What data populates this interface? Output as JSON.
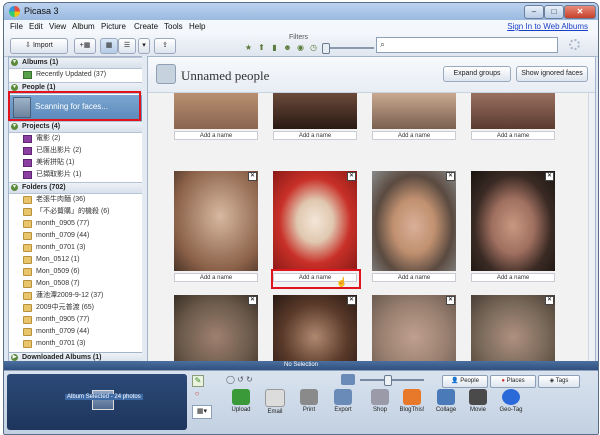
{
  "window": {
    "title": "Picasa 3",
    "min": "–",
    "max": "□",
    "close": "✕"
  },
  "menu": [
    "File",
    "Edit",
    "View",
    "Album",
    "Picture",
    "Create",
    "Tools",
    "Help"
  ],
  "signin": "Sign In to Web Albums",
  "toolbar": {
    "import_label": "Import",
    "filters_label": "Filters",
    "search_value": ""
  },
  "sidebar": {
    "albums": {
      "label": "Albums (1)",
      "items": [
        {
          "label": "Recently Updated (37)"
        }
      ]
    },
    "people": {
      "label": "People (1)",
      "scanning": "Scanning for faces..."
    },
    "projects": {
      "label": "Projects (4)",
      "items": [
        {
          "label": "電影 (2)"
        },
        {
          "label": "已匯出影片 (2)"
        },
        {
          "label": "美術拼貼 (1)"
        },
        {
          "label": "已擷取影片 (1)"
        }
      ]
    },
    "folders": {
      "label": "Folders (702)",
      "items": [
        {
          "label": "老張牛肉麵 (36)"
        },
        {
          "label": "「不必贅購」的機殺 (6)"
        },
        {
          "label": "month_0905 (77)"
        },
        {
          "label": "month_0709 (44)"
        },
        {
          "label": "month_0701 (3)"
        },
        {
          "label": "Mon_0512 (1)"
        },
        {
          "label": "Mon_0509 (6)"
        },
        {
          "label": "Mon_0508 (7)"
        },
        {
          "label": "蓮池潭2009-9-12 (37)"
        },
        {
          "label": "2009中元普渡 (65)"
        },
        {
          "label": "month_0905 (77)"
        },
        {
          "label": "month_0709 (44)"
        },
        {
          "label": "month_0701 (3)"
        }
      ]
    },
    "downloaded": {
      "label": "Downloaded Albums (1)"
    }
  },
  "main": {
    "title": "Unnamed people",
    "expand_label": "Expand groups",
    "show_ignored_label": "Show ignored faces",
    "add_name": "Add a name",
    "rows": [
      {
        "label": "row1",
        "faces": [
          "#b89070",
          "#6a4a3a",
          "#c8a890",
          "#9a7060"
        ]
      },
      {
        "label": "row2",
        "faces": [
          "#c8a088",
          "#c83028",
          "#5a4a40",
          "#3a2a24"
        ]
      },
      {
        "label": "row3",
        "faces": [
          "#6a5a4a",
          "#3a2a20",
          "#9a8070",
          "#7a6a5a"
        ]
      }
    ]
  },
  "status": {
    "selection": "No Selection"
  },
  "tray": {
    "album_selected": "Album Selected - 24 photos",
    "tabs": [
      {
        "label": "People"
      },
      {
        "label": "Places"
      },
      {
        "label": "Tags"
      }
    ],
    "actions": [
      {
        "label": "Upload",
        "color": "#3a9a3a"
      },
      {
        "label": "Email",
        "color": "#dcdcdc"
      },
      {
        "label": "Print",
        "color": "#8a8a8a"
      },
      {
        "label": "Export",
        "color": "#6a8ab8"
      },
      {
        "label": "Shop",
        "color": "#9a9aa8"
      },
      {
        "label": "BlogThis!",
        "color": "#e8782a"
      },
      {
        "label": "Collage",
        "color": "#4a7ab8"
      },
      {
        "label": "Movie",
        "color": "#4a4a4a"
      },
      {
        "label": "Geo-Tag",
        "color": "#2a6ad8"
      }
    ]
  }
}
